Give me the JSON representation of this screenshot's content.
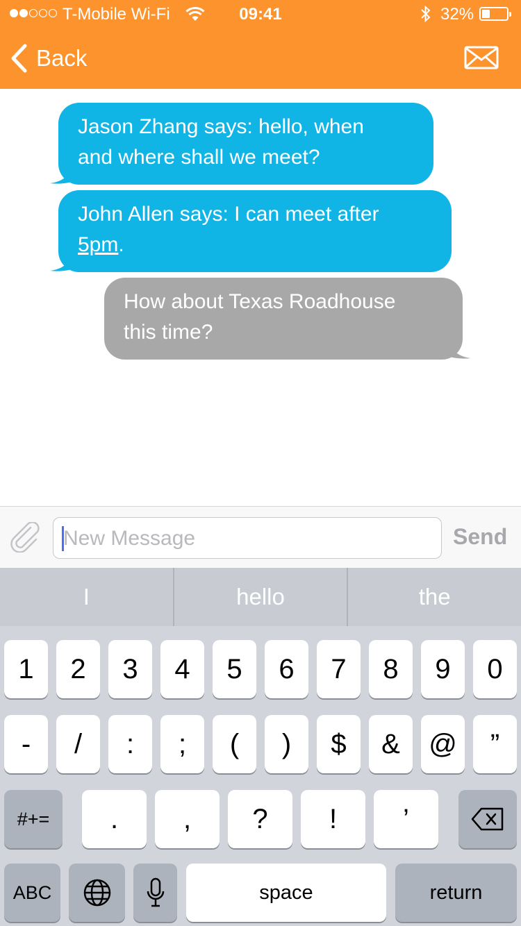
{
  "status_bar": {
    "carrier": "T-Mobile Wi-Fi",
    "time": "09:41",
    "battery_percent": "32%",
    "battery_level": 0.32,
    "signal_bars_filled": 2,
    "signal_bars_total": 5,
    "icons": [
      "wifi-icon",
      "bluetooth-icon",
      "battery-icon"
    ]
  },
  "nav": {
    "back_label": "Back",
    "back_icon": "chevron-left-icon",
    "mail_icon": "envelope-icon",
    "color": "#fd932d"
  },
  "messages": [
    {
      "direction": "incoming",
      "line1": "Jason Zhang says: hello, when",
      "line2": "and where shall we meet?",
      "color": "#10b4e5"
    },
    {
      "direction": "incoming",
      "line1": "John Allen says: I can meet after",
      "line2_link": "5pm",
      "line2_rest": ".",
      "color": "#10b4e5"
    },
    {
      "direction": "outgoing",
      "line1": "How about Texas Roadhouse",
      "line2": "this time?",
      "color": "#a8a8a8"
    }
  ],
  "composer": {
    "attach_icon": "paperclip-icon",
    "placeholder": "New Message",
    "send_label": "Send"
  },
  "keyboard": {
    "predictions": [
      "I",
      "hello",
      "the"
    ],
    "row1": [
      "1",
      "2",
      "3",
      "4",
      "5",
      "6",
      "7",
      "8",
      "9",
      "0"
    ],
    "row2": [
      "-",
      "/",
      ":",
      ";",
      "(",
      ")",
      "$",
      "&",
      "@",
      "”"
    ],
    "row3": {
      "symbols": "#+=",
      "keys": [
        ".",
        ",",
        "?",
        "!",
        "’"
      ],
      "delete_icon": "backspace-icon"
    },
    "row4": {
      "abc": "ABC",
      "globe_icon": "globe-icon",
      "mic_icon": "microphone-icon",
      "space": "space",
      "return": "return"
    }
  }
}
